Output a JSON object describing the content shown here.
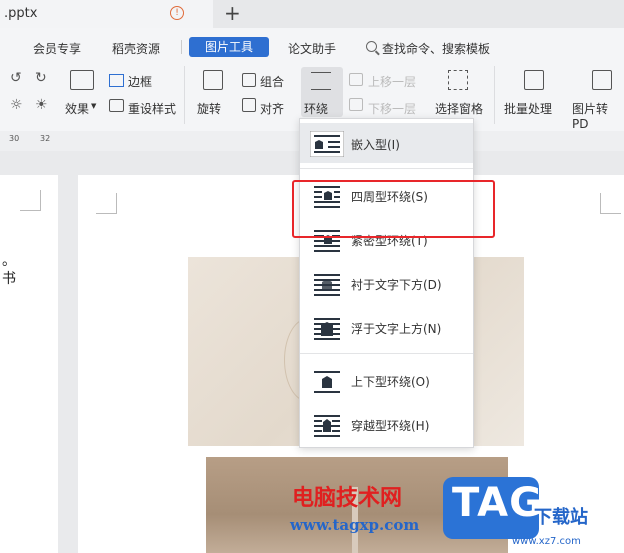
{
  "tabbar": {
    "doc_title": ".pptx",
    "close_glyph": "!",
    "new_tab_glyph": "+"
  },
  "menu_tabs": {
    "member": "会员专享",
    "templates": "稻壳资源",
    "picture_tools": "图片工具",
    "paper_assistant": "论文助手",
    "search": "查找命令、搜索模板"
  },
  "ribbon": {
    "effects": "效果",
    "border": "边框",
    "reset_style": "重设样式",
    "rotate": "旋转",
    "group": "组合",
    "align": "对齐",
    "wrap": "环绕",
    "bring_forward": "上移一层",
    "send_backward": "下移一层",
    "selection_pane": "选择窗格",
    "batch_process": "批量处理",
    "pic_to_pdf": "图片转PD"
  },
  "ruler": {
    "left_num": "30",
    "right_num": "32"
  },
  "document": {
    "side_text_1": "。",
    "side_text_2": "书"
  },
  "wrap_menu": {
    "items": [
      {
        "label": "嵌入型(I)",
        "icon": "inline-wrap-icon",
        "selected": true
      },
      {
        "label": "四周型环绕(S)",
        "icon": "square-wrap-icon",
        "selected": false
      },
      {
        "label": "紧密型环绕(T)",
        "icon": "tight-wrap-icon",
        "selected": false
      },
      {
        "label": "衬于文字下方(D)",
        "icon": "behind-text-icon",
        "selected": false
      },
      {
        "label": "浮于文字上方(N)",
        "icon": "in-front-of-text-icon",
        "selected": false
      },
      {
        "label": "上下型环绕(O)",
        "icon": "top-bottom-wrap-icon",
        "selected": false
      },
      {
        "label": "穿越型环绕(H)",
        "icon": "through-wrap-icon",
        "selected": false
      }
    ]
  },
  "watermark": {
    "site_name": "电脑技术网",
    "site_url": "www.tagxp.com",
    "tag_logo": "TAG",
    "site2": "下载站",
    "site2_url": "www.xz7.com"
  },
  "colors": {
    "accent": "#2e6fd1",
    "highlight": "#e8262a",
    "watermark_red": "#e02020",
    "watermark_blue": "#2566c9"
  }
}
